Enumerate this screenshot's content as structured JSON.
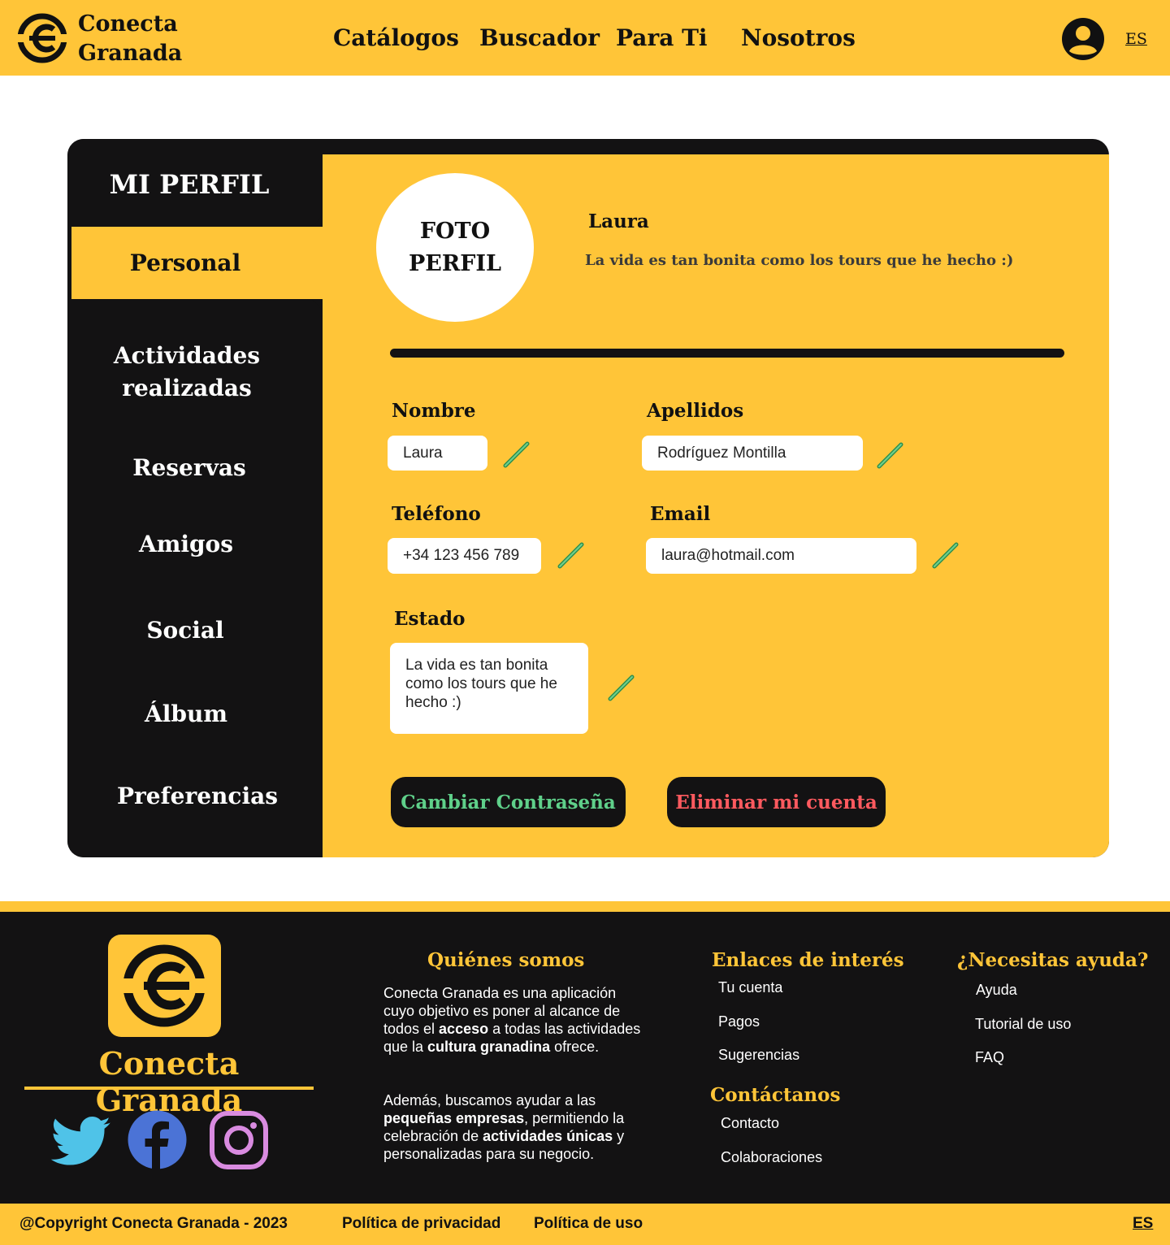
{
  "header": {
    "brand_line1": "Conecta",
    "brand_line2": "Granada",
    "nav": [
      "Catálogos",
      "Buscador",
      "Para Ti",
      "Nosotros"
    ],
    "language": "ES",
    "brand_color": "#ffc538"
  },
  "sidebar": {
    "title": "MI PERFIL",
    "items": [
      {
        "label": "Personal",
        "active": true
      },
      {
        "label": "Actividades realizadas"
      },
      {
        "label": "Reservas"
      },
      {
        "label": "Amigos"
      },
      {
        "label": "Social"
      },
      {
        "label": "Álbum"
      },
      {
        "label": "Preferencias"
      }
    ]
  },
  "profile": {
    "photo_label_line1": "FOTO",
    "photo_label_line2": "PERFIL",
    "name": "Laura",
    "status": "La vida es tan bonita como los tours que he hecho :)"
  },
  "form": {
    "nombre_label": "Nombre",
    "nombre_value": "Laura",
    "apellidos_label": "Apellidos",
    "apellidos_value": "Rodríguez Montilla",
    "telefono_label": "Teléfono",
    "telefono_value": "+34 123 456 789",
    "email_label": "Email",
    "email_value": "laura@hotmail.com",
    "estado_label": "Estado",
    "estado_value": "La vida es tan bonita como los tours que he hecho :)",
    "edit_icon": "pencil-icon"
  },
  "actions": {
    "change_password": "Cambiar Contraseña",
    "delete_account": "Eliminar mi cuenta",
    "change_password_color": "#5fd08a",
    "delete_account_color": "#ff5a5f"
  },
  "footer": {
    "brand_name": "Conecta Granada",
    "social": [
      "twitter-icon",
      "facebook-icon",
      "instagram-icon"
    ],
    "about_title": "Quiénes somos",
    "about_p1_a": "Conecta Granada es una aplicación cuyo objetivo es poner al alcance de todos el ",
    "about_p1_b": "acceso",
    "about_p1_c": " a todas las actividades que la ",
    "about_p1_d": "cultura granadina",
    "about_p1_e": " ofrece.",
    "about_p2_a": "Además, buscamos ayudar a las ",
    "about_p2_b": "pequeñas empresas",
    "about_p2_c": ", permitiendo la celebración de ",
    "about_p2_d": "actividades únicas",
    "about_p2_e": " y personalizadas para su negocio.",
    "links_title": "Enlaces de interés",
    "links": [
      "Tu cuenta",
      "Pagos",
      "Sugerencias"
    ],
    "contact_title": "Contáctanos",
    "contact_links": [
      "Contacto",
      "Colaboraciones"
    ],
    "help_title": "¿Necesitas ayuda?",
    "help_links": [
      "Ayuda",
      "Tutorial de uso",
      "FAQ"
    ]
  },
  "bottom_bar": {
    "copyright": "@Copyright Conecta Granada - 2023",
    "privacy": "Política de privacidad",
    "usage": "Política de uso",
    "language": "ES"
  }
}
